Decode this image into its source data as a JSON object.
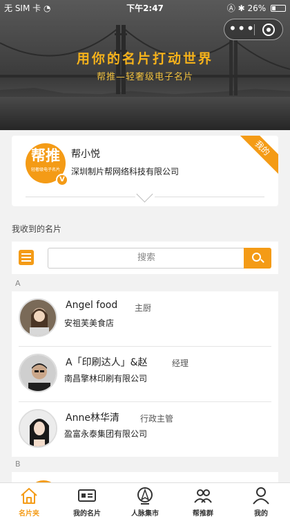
{
  "status_bar": {
    "carrier": "无 SIM 卡",
    "time": "下午2:47",
    "battery": "26%"
  },
  "hero": {
    "title": "用你的名片打动世界",
    "subtitle": "帮推—轻奢级电子名片"
  },
  "my_card": {
    "ribbon": "我的",
    "logo_text": "帮推",
    "logo_subtext": "轻奢级电子名片",
    "logo_badge": "V",
    "name": "帮小悦",
    "company": "深圳制片帮网络科技有限公司"
  },
  "section_title": "我收到的名片",
  "search": {
    "placeholder": "搜索"
  },
  "groups": [
    {
      "letter": "A",
      "contacts": [
        {
          "name": "Angel food",
          "title": "主厨",
          "company": "安祖芙美食店"
        },
        {
          "name": "A「印刷达人」&赵",
          "title": "经理",
          "company": "南昌擎林印刷有限公司"
        },
        {
          "name": "Anne林华清",
          "title": "行政主管",
          "company": "盈富永泰集团有限公司"
        }
      ]
    },
    {
      "letter": "B",
      "contacts": []
    }
  ],
  "tabbar": {
    "tabs": [
      {
        "label": "名片夹",
        "icon": "home-icon",
        "active": true
      },
      {
        "label": "我的名片",
        "icon": "card-icon",
        "active": false
      },
      {
        "label": "人脉集市",
        "icon": "location-icon",
        "active": false
      },
      {
        "label": "帮推群",
        "icon": "group-icon",
        "active": false
      },
      {
        "label": "我的",
        "icon": "user-icon",
        "active": false
      }
    ]
  },
  "colors": {
    "accent": "#f49b16",
    "hero_text": "#f7b31b"
  }
}
